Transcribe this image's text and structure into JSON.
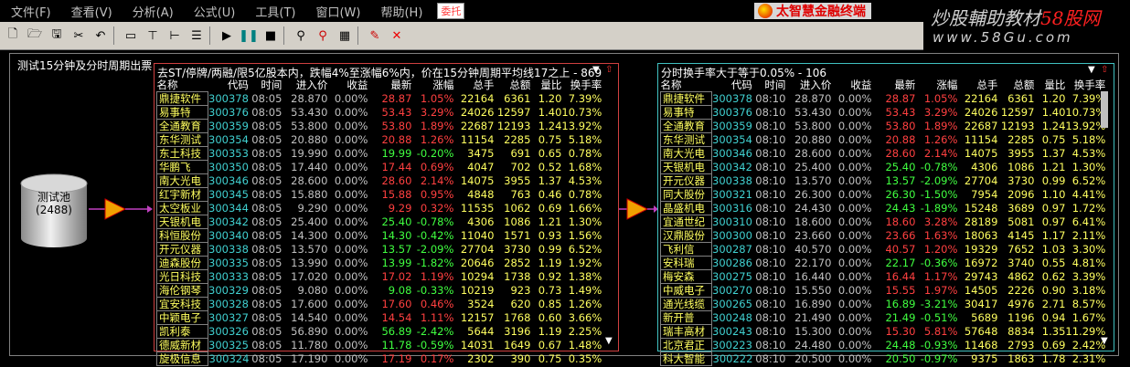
{
  "menu": [
    "文件(F)",
    "查看(V)",
    "分析(A)",
    "公式(U)",
    "工具(T)",
    "窗口(W)",
    "帮助(H)"
  ],
  "menu_tab": "委托",
  "brand": "太智慧金融终端",
  "watermark": {
    "line1_a": "炒股輔助教材",
    "line1_b": "58股网",
    "line2": "www.58Gu.com"
  },
  "workspace_title": "测试15分钟及分时周期出票",
  "pool": {
    "name": "测试池",
    "count": "(2488)"
  },
  "left_panel": {
    "title": "去ST/停牌/两融/限5亿股本内，跌幅4%至涨幅6%内，价在15分钟周期平均线17之上 - 869",
    "headers": [
      "名称",
      "代码",
      "时间",
      "进入价",
      "收益",
      "最新",
      "涨幅",
      "总手",
      "总额",
      "量比",
      "换手率"
    ],
    "rows": [
      [
        "鼎捷软件",
        "300378",
        "08:05",
        "28.870",
        "0.00%",
        "28.87",
        "1.05%",
        "22164",
        "6361",
        "1.20",
        "7.39%"
      ],
      [
        "易事特",
        "300376",
        "08:05",
        "53.430",
        "0.00%",
        "53.43",
        "3.29%",
        "24026",
        "12597",
        "1.40",
        "10.73%"
      ],
      [
        "全通教育",
        "300359",
        "08:05",
        "53.800",
        "0.00%",
        "53.80",
        "1.89%",
        "22687",
        "12193",
        "1.24",
        "13.92%"
      ],
      [
        "东华测试",
        "300354",
        "08:05",
        "20.880",
        "0.00%",
        "20.88",
        "1.26%",
        "11154",
        "2285",
        "0.75",
        "5.18%"
      ],
      [
        "东土科技",
        "300353",
        "08:05",
        "19.990",
        "0.00%",
        "19.99",
        "-0.20%",
        "3475",
        "691",
        "0.65",
        "0.78%"
      ],
      [
        "华鹏飞",
        "300350",
        "08:05",
        "17.440",
        "0.00%",
        "17.44",
        "0.69%",
        "4047",
        "702",
        "0.52",
        "1.68%"
      ],
      [
        "南大光电",
        "300346",
        "08:05",
        "28.600",
        "0.00%",
        "28.60",
        "2.14%",
        "14075",
        "3955",
        "1.37",
        "4.53%"
      ],
      [
        "红宇新材",
        "300345",
        "08:05",
        "15.880",
        "0.00%",
        "15.88",
        "0.95%",
        "4848",
        "763",
        "0.46",
        "0.78%"
      ],
      [
        "太空板业",
        "300344",
        "08:05",
        "9.290",
        "0.00%",
        "9.29",
        "0.32%",
        "11535",
        "1062",
        "0.69",
        "1.66%"
      ],
      [
        "天银机电",
        "300342",
        "08:05",
        "25.400",
        "0.00%",
        "25.40",
        "-0.78%",
        "4306",
        "1086",
        "1.21",
        "1.30%"
      ],
      [
        "科恒股份",
        "300340",
        "08:05",
        "14.300",
        "0.00%",
        "14.30",
        "-0.42%",
        "11040",
        "1571",
        "0.93",
        "1.56%"
      ],
      [
        "开元仪器",
        "300338",
        "08:05",
        "13.570",
        "0.00%",
        "13.57",
        "-2.09%",
        "27704",
        "3730",
        "0.99",
        "6.52%"
      ],
      [
        "迪森股份",
        "300335",
        "08:05",
        "13.990",
        "0.00%",
        "13.99",
        "-1.82%",
        "20646",
        "2852",
        "1.19",
        "1.92%"
      ],
      [
        "光日科技",
        "300333",
        "08:05",
        "17.020",
        "0.00%",
        "17.02",
        "1.19%",
        "10294",
        "1738",
        "0.92",
        "1.38%"
      ],
      [
        "海伦钢琴",
        "300329",
        "08:05",
        "9.080",
        "0.00%",
        "9.08",
        "-0.33%",
        "10219",
        "923",
        "0.73",
        "1.49%"
      ],
      [
        "宜安科技",
        "300328",
        "08:05",
        "17.600",
        "0.00%",
        "17.60",
        "0.46%",
        "3524",
        "620",
        "0.85",
        "1.26%"
      ],
      [
        "中颖电子",
        "300327",
        "08:05",
        "14.540",
        "0.00%",
        "14.54",
        "1.11%",
        "12157",
        "1768",
        "0.60",
        "3.66%"
      ],
      [
        "凯利泰",
        "300326",
        "08:05",
        "56.890",
        "0.00%",
        "56.89",
        "-2.42%",
        "5644",
        "3196",
        "1.19",
        "2.25%"
      ],
      [
        "德威新材",
        "300325",
        "08:05",
        "11.780",
        "0.00%",
        "11.78",
        "-0.59%",
        "14031",
        "1649",
        "0.67",
        "1.48%"
      ],
      [
        "旋极信息",
        "300324",
        "08:05",
        "17.190",
        "0.00%",
        "17.19",
        "0.17%",
        "2302",
        "390",
        "0.75",
        "0.35%"
      ]
    ]
  },
  "right_panel": {
    "title": "分时换手率大于等于0.05% - 106",
    "headers": [
      "名称",
      "代码",
      "时间",
      "进入价",
      "收益",
      "最新",
      "涨幅",
      "总手",
      "总额",
      "量比",
      "换手率"
    ],
    "rows": [
      [
        "鼎捷软件",
        "300378",
        "08:10",
        "28.870",
        "0.00%",
        "28.87",
        "1.05%",
        "22164",
        "6361",
        "1.20",
        "7.39%"
      ],
      [
        "易事特",
        "300376",
        "08:10",
        "53.430",
        "0.00%",
        "53.43",
        "3.29%",
        "24026",
        "12597",
        "1.40",
        "10.73%"
      ],
      [
        "全通教育",
        "300359",
        "08:10",
        "53.800",
        "0.00%",
        "53.80",
        "1.89%",
        "22687",
        "12193",
        "1.24",
        "13.92%"
      ],
      [
        "东华测试",
        "300354",
        "08:10",
        "20.880",
        "0.00%",
        "20.88",
        "1.26%",
        "11154",
        "2285",
        "0.75",
        "5.18%"
      ],
      [
        "南大光电",
        "300346",
        "08:10",
        "28.600",
        "0.00%",
        "28.60",
        "2.14%",
        "14075",
        "3955",
        "1.37",
        "4.53%"
      ],
      [
        "天银机电",
        "300342",
        "08:10",
        "25.400",
        "0.00%",
        "25.40",
        "-0.78%",
        "4306",
        "1086",
        "1.21",
        "1.30%"
      ],
      [
        "开元仪器",
        "300338",
        "08:10",
        "13.570",
        "0.00%",
        "13.57",
        "-2.09%",
        "27704",
        "3730",
        "0.99",
        "6.52%"
      ],
      [
        "同大股份",
        "300321",
        "08:10",
        "26.300",
        "0.00%",
        "26.30",
        "-1.50%",
        "7954",
        "2096",
        "1.10",
        "4.41%"
      ],
      [
        "晶盛机电",
        "300316",
        "08:10",
        "24.430",
        "0.00%",
        "24.43",
        "-1.89%",
        "15248",
        "3689",
        "0.97",
        "1.72%"
      ],
      [
        "宜通世纪",
        "300310",
        "08:10",
        "18.600",
        "0.00%",
        "18.60",
        "3.28%",
        "28189",
        "5081",
        "0.97",
        "6.41%"
      ],
      [
        "汉鼎股份",
        "300300",
        "08:10",
        "23.660",
        "0.00%",
        "23.66",
        "1.63%",
        "18063",
        "4145",
        "1.17",
        "2.11%"
      ],
      [
        "飞利信",
        "300287",
        "08:10",
        "40.570",
        "0.00%",
        "40.57",
        "1.20%",
        "19329",
        "7652",
        "1.03",
        "3.30%"
      ],
      [
        "安科瑞",
        "300286",
        "08:10",
        "22.170",
        "0.00%",
        "22.17",
        "-0.36%",
        "16972",
        "3740",
        "0.55",
        "4.81%"
      ],
      [
        "梅安森",
        "300275",
        "08:10",
        "16.440",
        "0.00%",
        "16.44",
        "1.17%",
        "29743",
        "4862",
        "0.62",
        "3.39%"
      ],
      [
        "中威电子",
        "300270",
        "08:10",
        "15.550",
        "0.00%",
        "15.55",
        "1.97%",
        "14505",
        "2226",
        "0.90",
        "3.18%"
      ],
      [
        "通光线缆",
        "300265",
        "08:10",
        "16.890",
        "0.00%",
        "16.89",
        "-3.21%",
        "30417",
        "4976",
        "2.71",
        "8.57%"
      ],
      [
        "新开普",
        "300248",
        "08:10",
        "21.490",
        "0.00%",
        "21.49",
        "-0.51%",
        "5689",
        "1196",
        "0.94",
        "1.67%"
      ],
      [
        "瑞丰高材",
        "300243",
        "08:10",
        "15.300",
        "0.00%",
        "15.30",
        "5.81%",
        "57648",
        "8834",
        "1.35",
        "11.29%"
      ],
      [
        "北京君正",
        "300223",
        "08:10",
        "24.480",
        "0.00%",
        "24.48",
        "-0.93%",
        "11468",
        "2793",
        "0.69",
        "2.42%"
      ],
      [
        "科大智能",
        "300222",
        "08:10",
        "20.500",
        "0.00%",
        "20.50",
        "-0.97%",
        "9375",
        "1863",
        "1.78",
        "2.31%"
      ]
    ]
  }
}
